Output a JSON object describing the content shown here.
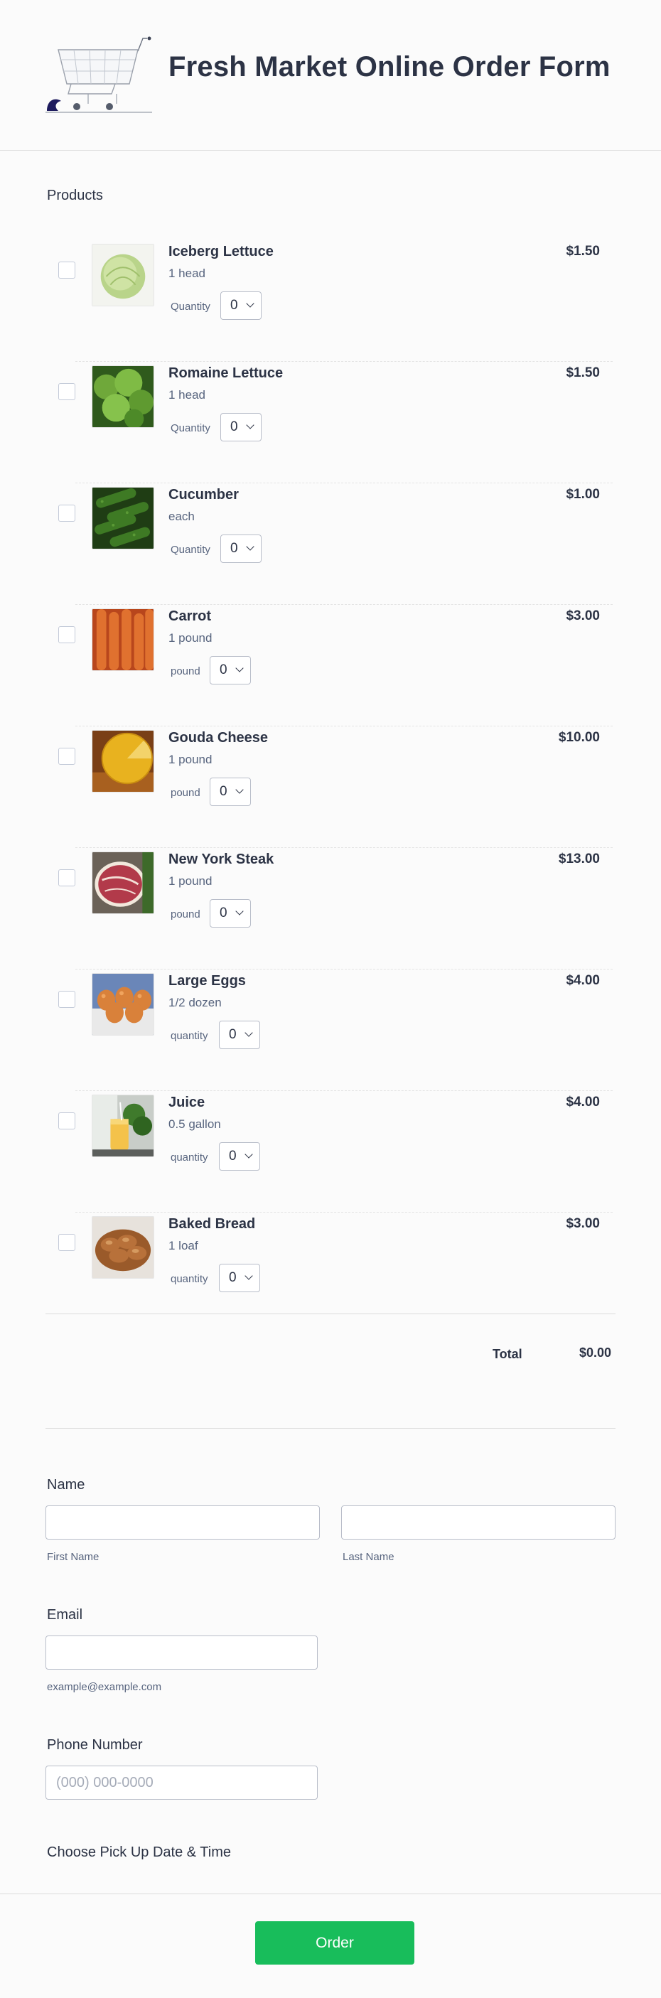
{
  "form": {
    "title": "Fresh Market Online Order Form",
    "products_label": "Products",
    "total_label": "Total",
    "total_value": "$0.00"
  },
  "products": [
    {
      "name": "Iceberg Lettuce",
      "desc": "1 head",
      "price": "$1.50",
      "qty_label": "Quantity",
      "qty_value": "0",
      "checked": false
    },
    {
      "name": "Romaine Lettuce",
      "desc": "1 head",
      "price": "$1.50",
      "qty_label": "Quantity",
      "qty_value": "0",
      "checked": false
    },
    {
      "name": "Cucumber",
      "desc": "each",
      "price": "$1.00",
      "qty_label": "Quantity",
      "qty_value": "0",
      "checked": false
    },
    {
      "name": "Carrot",
      "desc": "1 pound",
      "price": "$3.00",
      "qty_label": "pound",
      "qty_value": "0",
      "checked": false
    },
    {
      "name": "Gouda Cheese",
      "desc": "1 pound",
      "price": "$10.00",
      "qty_label": "pound",
      "qty_value": "0",
      "checked": false
    },
    {
      "name": "New York Steak",
      "desc": "1 pound",
      "price": "$13.00",
      "qty_label": "pound",
      "qty_value": "0",
      "checked": false
    },
    {
      "name": "Large Eggs",
      "desc": "1/2 dozen",
      "price": "$4.00",
      "qty_label": "quantity",
      "qty_value": "0",
      "checked": false
    },
    {
      "name": "Juice",
      "desc": "0.5 gallon",
      "price": "$4.00",
      "qty_label": "quantity",
      "qty_value": "0",
      "checked": false
    },
    {
      "name": "Baked Bread",
      "desc": "1 loaf",
      "price": "$3.00",
      "qty_label": "quantity",
      "qty_value": "0",
      "checked": false
    }
  ],
  "name_field": {
    "label": "Name",
    "first_value": "",
    "first_sublabel": "First Name",
    "last_value": "",
    "last_sublabel": "Last Name"
  },
  "email_field": {
    "label": "Email",
    "value": "",
    "sublabel": "example@example.com"
  },
  "phone_field": {
    "label": "Phone Number",
    "value": "",
    "placeholder": "(000) 000-0000"
  },
  "pickup_field": {
    "label": "Choose Pick Up Date & Time"
  },
  "submit": {
    "label": "Order"
  },
  "colors": {
    "accent": "#18bd5b",
    "text": "#2c3345",
    "muted": "#57647e",
    "border": "#b8bdc9"
  },
  "icons": {
    "logo": "shopping-cart-icon",
    "dropdown": "chevron-down-icon"
  }
}
